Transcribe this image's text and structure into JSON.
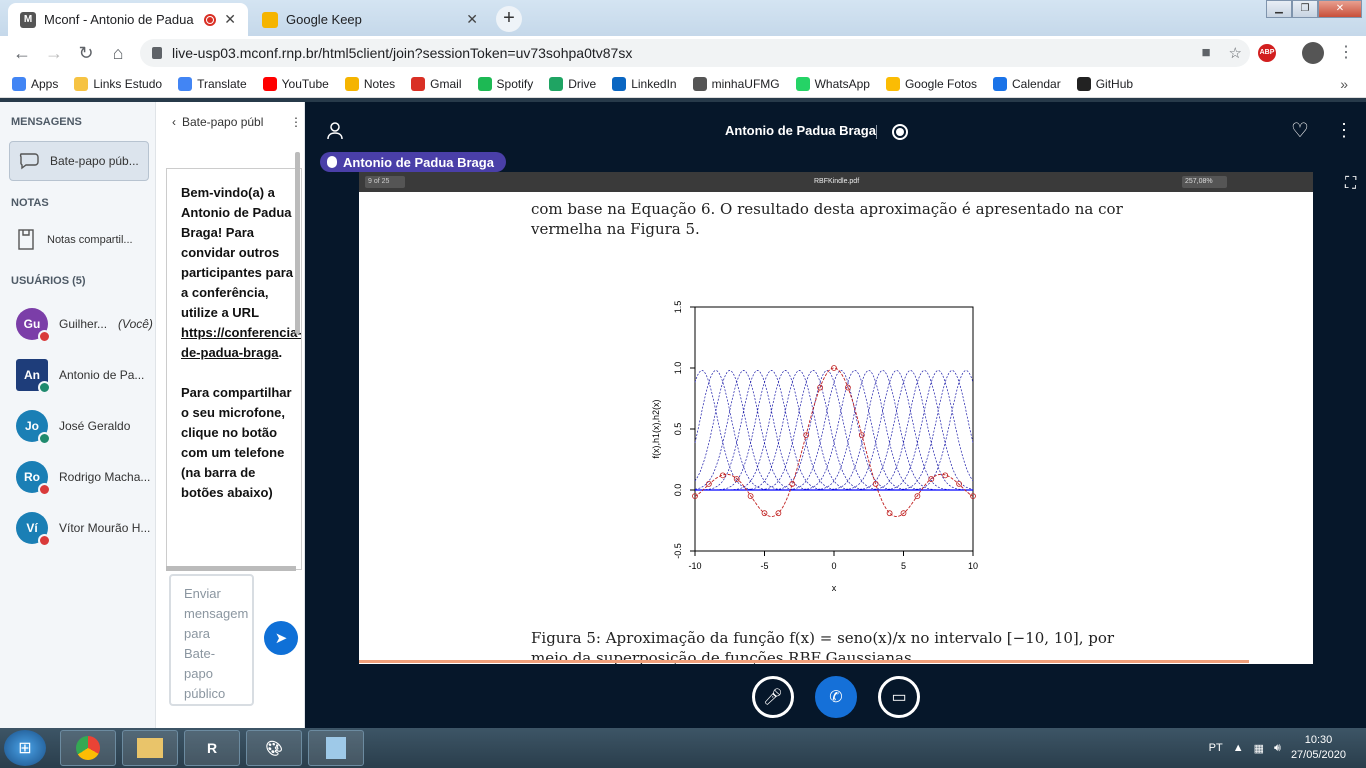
{
  "browser": {
    "tabs": [
      {
        "title": "Mconf - Antonio de Padua B",
        "favicon": "M"
      },
      {
        "title": "Google Keep",
        "favicon": "K"
      }
    ],
    "url": "live-usp03.mconf.rnp.br/html5client/join?sessionToken=uv73sohpa0tv87sx",
    "abp_label": "ABP"
  },
  "bookmarks": [
    {
      "label": "Apps",
      "color": "#4285f4"
    },
    {
      "label": "Links Estudo",
      "color": "#f6c343"
    },
    {
      "label": "Translate",
      "color": "#4285f4"
    },
    {
      "label": "YouTube",
      "color": "#ff0000"
    },
    {
      "label": "Notes",
      "color": "#f5b400"
    },
    {
      "label": "Gmail",
      "color": "#d93025"
    },
    {
      "label": "Spotify",
      "color": "#1db954"
    },
    {
      "label": "Drive",
      "color": "#1fa463"
    },
    {
      "label": "LinkedIn",
      "color": "#0a66c2"
    },
    {
      "label": "minhaUFMG",
      "color": "#555555"
    },
    {
      "label": "WhatsApp",
      "color": "#25d366"
    },
    {
      "label": "Google Fotos",
      "color": "#fbbc04"
    },
    {
      "label": "Calendar",
      "color": "#1a73e8"
    },
    {
      "label": "GitHub",
      "color": "#222222"
    }
  ],
  "sidebar": {
    "messages_header": "MENSAGENS",
    "public_chat": "Bate-papo púb...",
    "notes_header": "NOTAS",
    "shared_notes": "Notas compartil...",
    "users_header": "USUÁRIOS (5)",
    "users": [
      {
        "initials": "Gu",
        "name": "Guilher...",
        "you": "(Você)",
        "color": "#7b3ea8",
        "status": "muted"
      },
      {
        "initials": "An",
        "name": "Antonio de Pa...",
        "you": "",
        "color": "#1e3d7a",
        "status": "talking"
      },
      {
        "initials": "Jo",
        "name": "José Geraldo",
        "you": "",
        "color": "#1a7fb5",
        "status": "talking"
      },
      {
        "initials": "Ro",
        "name": "Rodrigo Macha...",
        "you": "",
        "color": "#1a7fb5",
        "status": "muted"
      },
      {
        "initials": "Ví",
        "name": "Vítor Mourão H...",
        "you": "",
        "color": "#1a7fb5",
        "status": "muted"
      }
    ]
  },
  "chat": {
    "header": "Bate-papo públ",
    "welcome_1": "Bem-vindo(a) a Antonio de Padua Braga! Para convidar outros participantes para a conferência, utilize a URL",
    "welcome_link": "https://conferencia-de-padua-braga",
    "welcome_2": "Para compartilhar o seu microfone, clique no botão com um telefone (na barra de botões abaixo)",
    "input_placeholder": "Enviar mensagem para Bate-papo público"
  },
  "meeting": {
    "title": "Antonio de Padua Braga",
    "talking": "Antonio de Padua Braga"
  },
  "presentation": {
    "pdf_page": "9 of 25",
    "pdf_name": "RBFKindle.pdf",
    "pdf_zoom": "257,08%",
    "text_line1": "com base na Equação 6.  O resultado desta aproximação é apresentado na cor",
    "text_line2": "vermelha na Figura 5.",
    "caption_line1": "Figura 5:  Aproximação da função  f(x) = seno(x)/x  no intervalo [−10, 10], por",
    "caption_line2": "meio da superposição de funções RBF Gaussianas."
  },
  "chart_data": {
    "type": "line",
    "xlabel": "x",
    "ylabel": "f(x),h1(x),h2(x)",
    "xlim": [
      -10,
      10
    ],
    "ylim": [
      -0.5,
      1.5
    ],
    "xticks": [
      -10,
      -5,
      0,
      5,
      10
    ],
    "yticks": [
      -0.5,
      0.0,
      0.5,
      1.0,
      1.5
    ],
    "series": [
      {
        "style": "gaussians",
        "color": "#1a1aa8",
        "centers": [
          -9.5,
          -8.5,
          -7.5,
          -6.5,
          -5.5,
          -4.5,
          -3.5,
          -2.5,
          -1.5,
          -0.5,
          0.5,
          1.5,
          2.5,
          3.5,
          4.5,
          5.5,
          6.5,
          7.5,
          8.5,
          9.5
        ],
        "amplitude": 0.98,
        "sigma": 1.1
      },
      {
        "style": "line",
        "color": "#c02020",
        "function": "sin(x)/x"
      },
      {
        "style": "points",
        "color": "#c02020",
        "x": [
          -10,
          -9,
          -8,
          -7,
          -6,
          -5,
          -4,
          -3,
          -2,
          -1,
          0,
          1,
          2,
          3,
          4,
          5,
          6,
          7,
          8,
          9,
          10
        ],
        "y": [
          -0.05,
          0.05,
          0.12,
          0.09,
          -0.05,
          -0.19,
          -0.19,
          0.05,
          0.45,
          0.84,
          1.0,
          0.84,
          0.45,
          0.05,
          -0.19,
          -0.19,
          -0.05,
          0.09,
          0.12,
          0.05,
          -0.05
        ]
      },
      {
        "style": "line",
        "color": "#0000ff",
        "function": "zero"
      }
    ]
  },
  "taskbar": {
    "apps": [
      "Chrome",
      "Explorer",
      "R",
      "Paint",
      "Notepad"
    ],
    "lang": "PT",
    "time": "10:30",
    "date": "27/05/2020"
  }
}
